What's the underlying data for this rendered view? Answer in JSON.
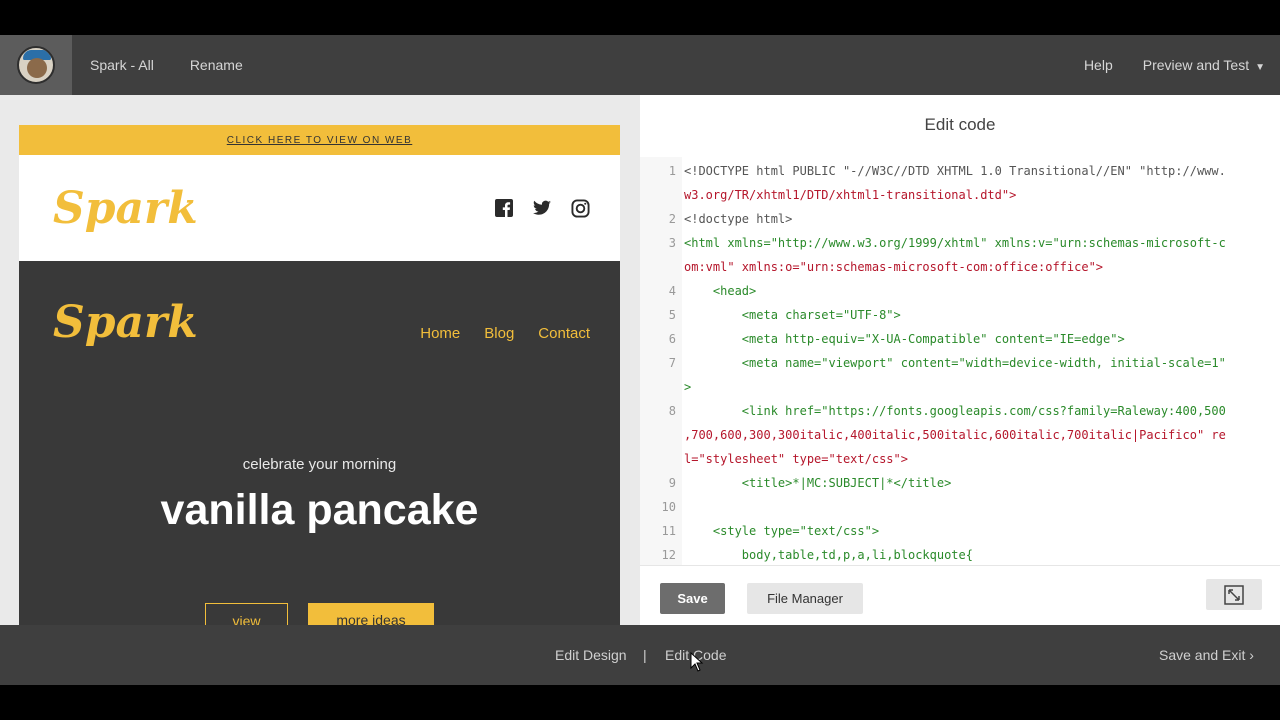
{
  "topbar": {
    "title": "Spark - All",
    "rename": "Rename",
    "help": "Help",
    "preview_test": "Preview and Test"
  },
  "preview": {
    "web_link": "CLICK HERE TO VIEW ON WEB",
    "brand": "Spark",
    "nav": [
      "Home",
      "Blog",
      "Contact"
    ],
    "tagline": "celebrate your morning",
    "headline": "vanilla pancake",
    "btn_view": "view",
    "btn_more": "more ideas"
  },
  "editor": {
    "title": "Edit code",
    "save": "Save",
    "file_manager": "File Manager",
    "line_numbers": [
      "1",
      "2",
      "3",
      "4",
      "5",
      "6",
      "7",
      "8",
      "9",
      "10",
      "11",
      "12"
    ],
    "lines": [
      "<!DOCTYPE html PUBLIC \"-//W3C//DTD XHTML 1.0 Transitional//EN\" \"http://www.",
      "w3.org/TR/xhtml1/DTD/xhtml1-transitional.dtd\">",
      "<!doctype html>",
      "<html xmlns=\"http://www.w3.org/1999/xhtml\" xmlns:v=\"urn:schemas-microsoft-c",
      "om:vml\" xmlns:o=\"urn:schemas-microsoft-com:office:office\">",
      "    <head>",
      "        <meta charset=\"UTF-8\">",
      "        <meta http-equiv=\"X-UA-Compatible\" content=\"IE=edge\">",
      "        <meta name=\"viewport\" content=\"width=device-width, initial-scale=1\"",
      ">",
      "        <link href=\"https://fonts.googleapis.com/css?family=Raleway:400,500",
      ",700,600,300,300italic,400italic,500italic,600italic,700italic|Pacifico\" re",
      "l=\"stylesheet\" type=\"text/css\">",
      "        <title>*|MC:SUBJECT|*</title>",
      "",
      "    <style type=\"text/css\">",
      "        body,table,td,p,a,li,blockquote{"
    ]
  },
  "bottombar": {
    "edit_design": "Edit Design",
    "separator": "|",
    "edit_code": "Edit Code",
    "save_exit": "Save and Exit"
  }
}
